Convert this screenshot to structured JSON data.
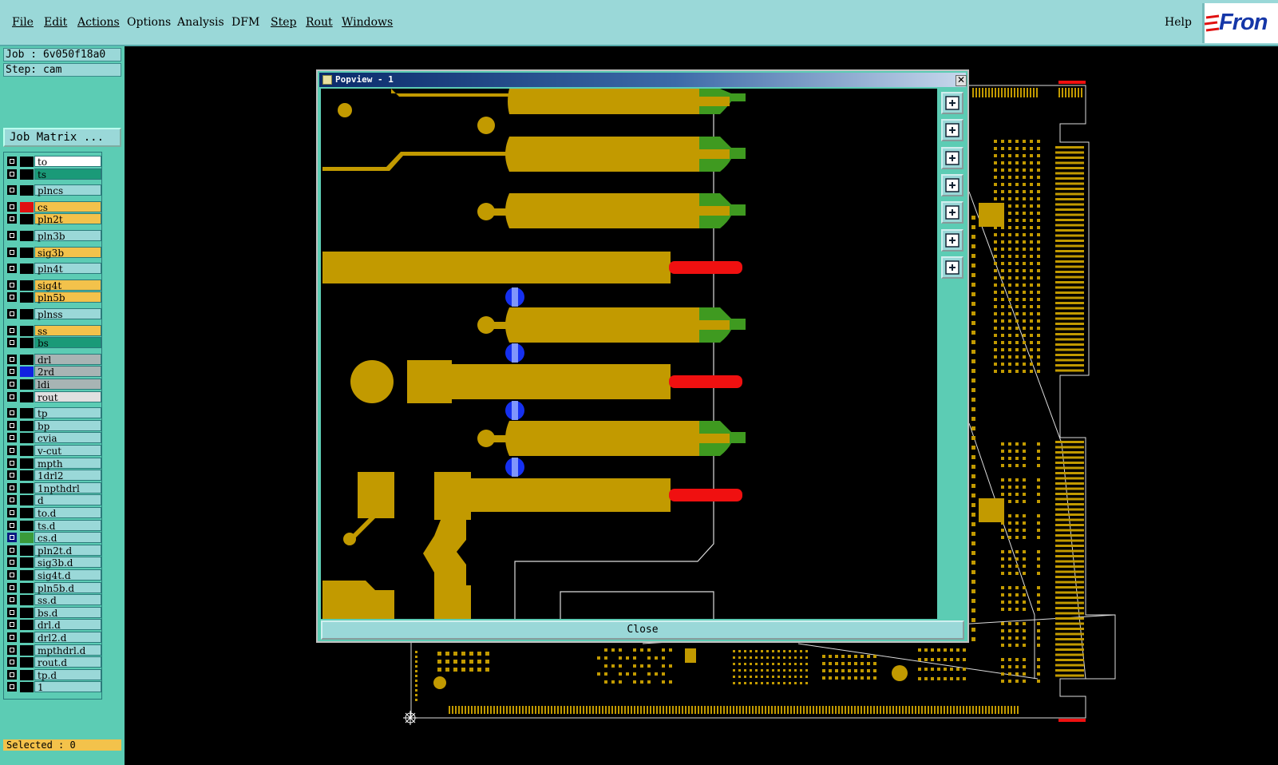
{
  "menubar": {
    "items": [
      "File",
      "Edit",
      "Actions",
      "Options",
      "Analysis",
      "DFM",
      "Step",
      "Rout",
      "Windows"
    ],
    "help": "Help",
    "logo_text": "Fron"
  },
  "left_panel": {
    "job_label": "Job : 6v050f18a0",
    "step_label": "Step: cam",
    "job_matrix_button": "Job Matrix ...",
    "selected_label": "Selected : 0"
  },
  "layers": [
    {
      "name": "to",
      "bg": "#ffffff",
      "swatch": "#000000"
    },
    {
      "name": "ts",
      "bg": "#1a9a78",
      "swatch": "#000000"
    },
    {
      "name": "plncs",
      "bg": "#9ad8d8",
      "swatch": "#000000"
    },
    {
      "name": "cs",
      "bg": "#f3c24b",
      "swatch": "#e01010"
    },
    {
      "name": "pln2t",
      "bg": "#f3c24b",
      "swatch": "#000000"
    },
    {
      "name": "pln3b",
      "bg": "#9ad8d8",
      "swatch": "#000000"
    },
    {
      "name": "sig3b",
      "bg": "#f3c24b",
      "swatch": "#000000"
    },
    {
      "name": "pln4t",
      "bg": "#9ad8d8",
      "swatch": "#000000"
    },
    {
      "name": "sig4t",
      "bg": "#f3c24b",
      "swatch": "#000000"
    },
    {
      "name": "pln5b",
      "bg": "#f3c24b",
      "swatch": "#000000"
    },
    {
      "name": "plnss",
      "bg": "#9ad8d8",
      "swatch": "#000000"
    },
    {
      "name": "ss",
      "bg": "#f3c24b",
      "swatch": "#000000"
    },
    {
      "name": "bs",
      "bg": "#1a9a78",
      "swatch": "#000000"
    },
    {
      "name": "drl",
      "bg": "#a8b4b4",
      "swatch": "#000000"
    },
    {
      "name": "2rd",
      "bg": "#a8b4b4",
      "swatch": "#1020e0"
    },
    {
      "name": "ldi",
      "bg": "#a8b4b4",
      "swatch": "#000000"
    },
    {
      "name": "rout",
      "bg": "#e0e0e0",
      "swatch": "#000000"
    },
    {
      "name": "tp",
      "bg": "#9ad8d8",
      "swatch": "#000000"
    },
    {
      "name": "bp",
      "bg": "#9ad8d8",
      "swatch": "#000000"
    },
    {
      "name": "cvia",
      "bg": "#9ad8d8",
      "swatch": "#000000"
    },
    {
      "name": "v-cut",
      "bg": "#9ad8d8",
      "swatch": "#000000"
    },
    {
      "name": "mpth",
      "bg": "#9ad8d8",
      "swatch": "#000000"
    },
    {
      "name": "1drl2",
      "bg": "#9ad8d8",
      "swatch": "#000000"
    },
    {
      "name": "1npthdrl",
      "bg": "#9ad8d8",
      "swatch": "#000000"
    },
    {
      "name": "d",
      "bg": "#9ad8d8",
      "swatch": "#000000"
    },
    {
      "name": "to.d",
      "bg": "#9ad8d8",
      "swatch": "#000000"
    },
    {
      "name": "ts.d",
      "bg": "#9ad8d8",
      "swatch": "#000000"
    },
    {
      "name": "cs.d",
      "bg": "#9ad8d8",
      "swatch": "#3a9a3a"
    },
    {
      "name": "pln2t.d",
      "bg": "#9ad8d8",
      "swatch": "#000000"
    },
    {
      "name": "sig3b.d",
      "bg": "#9ad8d8",
      "swatch": "#000000"
    },
    {
      "name": "sig4t.d",
      "bg": "#9ad8d8",
      "swatch": "#000000"
    },
    {
      "name": "pln5b.d",
      "bg": "#9ad8d8",
      "swatch": "#000000"
    },
    {
      "name": "ss.d",
      "bg": "#9ad8d8",
      "swatch": "#000000"
    },
    {
      "name": "bs.d",
      "bg": "#9ad8d8",
      "swatch": "#000000"
    },
    {
      "name": "drl.d",
      "bg": "#9ad8d8",
      "swatch": "#000000"
    },
    {
      "name": "drl2.d",
      "bg": "#9ad8d8",
      "swatch": "#000000"
    },
    {
      "name": "mpthdrl.d",
      "bg": "#9ad8d8",
      "swatch": "#000000"
    },
    {
      "name": "rout.d",
      "bg": "#9ad8d8",
      "swatch": "#000000"
    },
    {
      "name": "tp.d",
      "bg": "#9ad8d8",
      "swatch": "#000000"
    },
    {
      "name": "1",
      "bg": "#9ad8d8",
      "swatch": "#000000"
    }
  ],
  "popview": {
    "title": "Popview - 1",
    "close_x": "✕",
    "close_button": "Close",
    "tools": [
      "zoom-home-icon",
      "zoom-in-icon",
      "zoom-out-icon",
      "pan-left-icon",
      "pan-right-icon",
      "fit-icon",
      "center-icon"
    ]
  },
  "colors": {
    "copper": "#c29a00",
    "red_pad": "#f01010",
    "green_pad": "#3f9a20",
    "blue_via": "#1530f0",
    "panel": "#5cccb4",
    "menubar": "#9ad8d8"
  }
}
